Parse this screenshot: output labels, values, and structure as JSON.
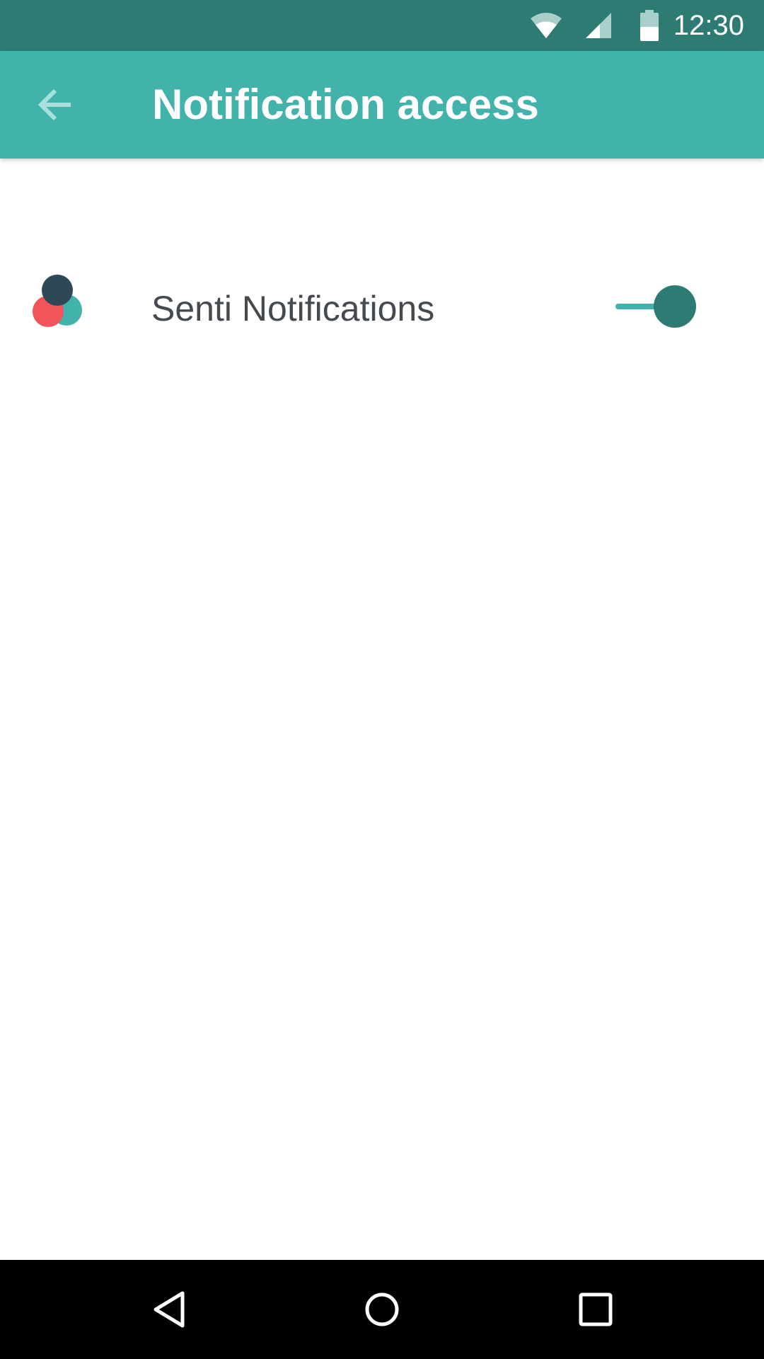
{
  "status_bar": {
    "time": "12:30",
    "icons": [
      "wifi-icon",
      "cell-signal-icon",
      "battery-icon"
    ]
  },
  "app_bar": {
    "title": "Notification access",
    "back_icon": "arrow-back-icon"
  },
  "list": {
    "items": [
      {
        "label": "Senti Notifications",
        "icon": "senti-app-icon",
        "enabled": true
      }
    ]
  },
  "nav_bar": {
    "icons": [
      "nav-back-icon",
      "nav-home-icon",
      "nav-recents-icon"
    ]
  },
  "colors": {
    "status_bar": "#2e7b74",
    "app_bar": "#41b3ab",
    "switch_thumb": "#2e7b74",
    "switch_track": "#41b3ab",
    "label_text": "#444a4f",
    "icon_dark": "#2f4858",
    "icon_red": "#f2545b",
    "icon_teal": "#41b3ab"
  }
}
